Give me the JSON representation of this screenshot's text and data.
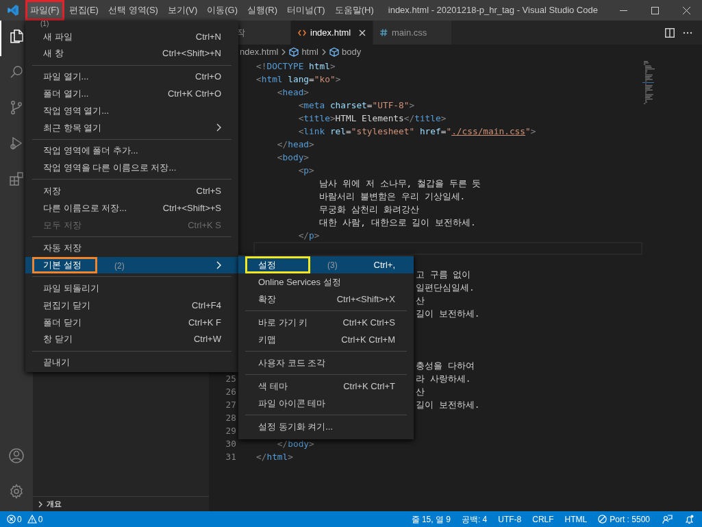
{
  "window": {
    "title": "index.html - 20201218-p_hr_tag - Visual Studio Code"
  },
  "menubar": [
    {
      "label": "파일(F)",
      "selected": true,
      "annotation": {
        "label": "(1)",
        "color": "#e3222c"
      }
    },
    {
      "label": "편집(E)",
      "selected": false
    },
    {
      "label": "선택 영역(S)",
      "selected": false
    },
    {
      "label": "보기(V)",
      "selected": false
    },
    {
      "label": "이동(G)",
      "selected": false
    },
    {
      "label": "실행(R)",
      "selected": false
    },
    {
      "label": "터미널(T)",
      "selected": false
    },
    {
      "label": "도움말(H)",
      "selected": false
    }
  ],
  "activity_bar": {
    "top": [
      {
        "kind": "files",
        "selected": true
      },
      {
        "kind": "search",
        "selected": false
      },
      {
        "kind": "source-control",
        "selected": false
      },
      {
        "kind": "run",
        "selected": false
      },
      {
        "kind": "extensions",
        "selected": false
      }
    ],
    "bottom": [
      {
        "kind": "account",
        "selected": false
      },
      {
        "kind": "settings",
        "selected": false
      }
    ]
  },
  "sidebar": {
    "section": {
      "label": "개요",
      "expanded": false
    }
  },
  "tabs": [
    {
      "label": "작",
      "kind": "plain",
      "selected": false
    },
    {
      "label": "index.html",
      "kind": "html",
      "selected": true
    },
    {
      "label": "main.css",
      "kind": "css",
      "selected": false
    }
  ],
  "breadcrumbs": [
    {
      "label": "ndex.html",
      "kind": "file"
    },
    {
      "label": "html",
      "kind": "element"
    },
    {
      "label": "body",
      "kind": "element"
    }
  ],
  "code_lines": [
    {
      "current": false,
      "tokens": [
        {
          "kind": "punct",
          "text": "<!"
        },
        {
          "kind": "tag",
          "text": "DOCTYPE"
        },
        {
          "kind": "attr",
          "text": " html"
        },
        {
          "kind": "punct",
          "text": ">"
        }
      ]
    },
    {
      "current": false,
      "tokens": [
        {
          "kind": "punct",
          "text": "<"
        },
        {
          "kind": "tag",
          "text": "html"
        },
        {
          "kind": "attr",
          "text": " lang"
        },
        {
          "kind": "text",
          "text": "="
        },
        {
          "kind": "string",
          "text": "\"ko\""
        },
        {
          "kind": "punct",
          "text": ">"
        }
      ]
    },
    {
      "current": false,
      "tokens": [
        {
          "kind": "punct",
          "text": "    <"
        },
        {
          "kind": "tag",
          "text": "head"
        },
        {
          "kind": "punct",
          "text": ">"
        }
      ]
    },
    {
      "current": false,
      "tokens": [
        {
          "kind": "punct",
          "text": "        <"
        },
        {
          "kind": "tag",
          "text": "meta"
        },
        {
          "kind": "attr",
          "text": " charset"
        },
        {
          "kind": "text",
          "text": "="
        },
        {
          "kind": "string",
          "text": "\"UTF-8\""
        },
        {
          "kind": "punct",
          "text": ">"
        }
      ]
    },
    {
      "current": false,
      "tokens": [
        {
          "kind": "punct",
          "text": "        <"
        },
        {
          "kind": "tag",
          "text": "title"
        },
        {
          "kind": "punct",
          "text": ">"
        },
        {
          "kind": "text",
          "text": "HTML Elements"
        },
        {
          "kind": "punct",
          "text": "</"
        },
        {
          "kind": "tag",
          "text": "title"
        },
        {
          "kind": "punct",
          "text": ">"
        }
      ]
    },
    {
      "current": false,
      "tokens": [
        {
          "kind": "punct",
          "text": "        <"
        },
        {
          "kind": "tag",
          "text": "link"
        },
        {
          "kind": "attr",
          "text": " rel"
        },
        {
          "kind": "text",
          "text": "="
        },
        {
          "kind": "string",
          "text": "\"stylesheet\""
        },
        {
          "kind": "attr",
          "text": " href"
        },
        {
          "kind": "text",
          "text": "="
        },
        {
          "kind": "string",
          "text": "\""
        },
        {
          "kind": "link",
          "text": "./css/main.css"
        },
        {
          "kind": "string",
          "text": "\""
        },
        {
          "kind": "punct",
          "text": ">"
        }
      ]
    },
    {
      "current": false,
      "tokens": [
        {
          "kind": "punct",
          "text": "    </"
        },
        {
          "kind": "tag",
          "text": "head"
        },
        {
          "kind": "punct",
          "text": ">"
        }
      ]
    },
    {
      "current": false,
      "tokens": [
        {
          "kind": "punct",
          "text": "    <"
        },
        {
          "kind": "tag",
          "text": "body"
        },
        {
          "kind": "punct",
          "text": ">"
        }
      ]
    },
    {
      "current": false,
      "tokens": [
        {
          "kind": "punct",
          "text": "        <"
        },
        {
          "kind": "tag",
          "text": "p"
        },
        {
          "kind": "punct",
          "text": ">"
        }
      ]
    },
    {
      "current": false,
      "tokens": [
        {
          "kind": "text",
          "text": "            남사 위에 저 소나무, 철갑을 두른 듯"
        }
      ]
    },
    {
      "current": false,
      "tokens": [
        {
          "kind": "text",
          "text": "            바람서리 불변함은 우리 기상일세."
        }
      ]
    },
    {
      "current": false,
      "tokens": [
        {
          "kind": "text",
          "text": "            무궁화 삼천리 화려강산"
        }
      ]
    },
    {
      "current": false,
      "tokens": [
        {
          "kind": "text",
          "text": "            대한 사람, 대한으로 길이 보전하세."
        }
      ]
    },
    {
      "current": false,
      "tokens": [
        {
          "kind": "punct",
          "text": "        </"
        },
        {
          "kind": "tag",
          "text": "p"
        },
        {
          "kind": "punct",
          "text": ">"
        }
      ]
    },
    {
      "current": true
    },
    {
      "current": false
    },
    {
      "current": false,
      "clipped": true,
      "tokens": [
        {
          "kind": "text",
          "text": "고 구름 없이"
        }
      ]
    },
    {
      "current": false,
      "clipped": true,
      "tokens": [
        {
          "kind": "text",
          "text": "일편단심일세."
        }
      ]
    },
    {
      "current": false,
      "clipped": true,
      "tokens": [
        {
          "kind": "text",
          "text": "산"
        }
      ]
    },
    {
      "current": false,
      "clipped": true,
      "tokens": [
        {
          "kind": "text",
          "text": "길이 보전하세."
        }
      ]
    },
    {
      "current": false
    },
    {
      "current": false
    },
    {
      "current": false
    },
    {
      "current": false,
      "clipped": true,
      "tokens": [
        {
          "kind": "text",
          "text": "충성을 다하여"
        }
      ]
    },
    {
      "current": false,
      "number": "25",
      "clipped": true,
      "tokens": [
        {
          "kind": "text",
          "text": "라 사랑하세."
        }
      ]
    },
    {
      "current": false,
      "number": "26",
      "clipped": true,
      "tokens": [
        {
          "kind": "text",
          "text": "산"
        }
      ]
    },
    {
      "current": false,
      "number": "27",
      "clipped": true,
      "tokens": [
        {
          "kind": "text",
          "text": "길이 보전하세."
        }
      ]
    },
    {
      "current": false,
      "number": "28"
    },
    {
      "current": false,
      "number": "29"
    },
    {
      "current": false,
      "number": "30",
      "tokens": [
        {
          "kind": "punct",
          "text": "    </"
        },
        {
          "kind": "tag",
          "text": "body"
        },
        {
          "kind": "punct",
          "text": ">"
        }
      ]
    },
    {
      "current": false,
      "number": "31",
      "tokens": [
        {
          "kind": "punct",
          "text": "</"
        },
        {
          "kind": "tag",
          "text": "html"
        },
        {
          "kind": "punct",
          "text": ">"
        }
      ]
    }
  ],
  "file_menu": [
    {
      "kind": "item",
      "label": "새 파일",
      "shortcut": "Ctrl+N",
      "selected": false,
      "disabled": false,
      "submenu": false
    },
    {
      "kind": "item",
      "label": "새 창",
      "shortcut": "Ctrl+<Shift>+N",
      "selected": false,
      "disabled": false,
      "submenu": false
    },
    {
      "kind": "separator"
    },
    {
      "kind": "item",
      "label": "파일 열기...",
      "shortcut": "Ctrl+O",
      "selected": false,
      "disabled": false,
      "submenu": false
    },
    {
      "kind": "item",
      "label": "폴더 열기...",
      "shortcut": "Ctrl+K Ctrl+O",
      "selected": false,
      "disabled": false,
      "submenu": false
    },
    {
      "kind": "item",
      "label": "작업 영역 열기...",
      "selected": false,
      "disabled": false,
      "submenu": false
    },
    {
      "kind": "item",
      "label": "최근 항목 열기",
      "selected": false,
      "disabled": false,
      "submenu": true
    },
    {
      "kind": "separator"
    },
    {
      "kind": "item",
      "label": "작업 영역에 폴더 추가...",
      "selected": false,
      "disabled": false,
      "submenu": false
    },
    {
      "kind": "item",
      "label": "작업 영역을 다른 이름으로 저장...",
      "selected": false,
      "disabled": false,
      "submenu": false
    },
    {
      "kind": "separator"
    },
    {
      "kind": "item",
      "label": "저장",
      "shortcut": "Ctrl+S",
      "selected": false,
      "disabled": false,
      "submenu": false
    },
    {
      "kind": "item",
      "label": "다른 이름으로 저장...",
      "shortcut": "Ctrl+<Shift>+S",
      "selected": false,
      "disabled": false,
      "submenu": false
    },
    {
      "kind": "item",
      "label": "모두 저장",
      "shortcut": "Ctrl+K S",
      "selected": false,
      "disabled": true,
      "submenu": false
    },
    {
      "kind": "separator"
    },
    {
      "kind": "item",
      "label": "자동 저장",
      "selected": false,
      "disabled": false,
      "submenu": false
    },
    {
      "kind": "item",
      "label": "기본 설정",
      "selected": true,
      "disabled": false,
      "submenu": true,
      "annotation": {
        "label": "(2)",
        "color": "#f0852d"
      }
    },
    {
      "kind": "separator"
    },
    {
      "kind": "item",
      "label": "파일 되돌리기",
      "selected": false,
      "disabled": false,
      "submenu": false
    },
    {
      "kind": "item",
      "label": "편집기 닫기",
      "shortcut": "Ctrl+F4",
      "selected": false,
      "disabled": false,
      "submenu": false
    },
    {
      "kind": "item",
      "label": "폴더 닫기",
      "shortcut": "Ctrl+K F",
      "selected": false,
      "disabled": false,
      "submenu": false
    },
    {
      "kind": "item",
      "label": "창 닫기",
      "shortcut": "Ctrl+W",
      "selected": false,
      "disabled": false,
      "submenu": false
    },
    {
      "kind": "separator"
    },
    {
      "kind": "item",
      "label": "끝내기",
      "selected": false,
      "disabled": false,
      "submenu": false
    }
  ],
  "preferences_menu": [
    {
      "kind": "item",
      "label": "설정",
      "shortcut": "Ctrl+,",
      "selected": true,
      "disabled": false,
      "submenu": false,
      "annotation": {
        "label": "(3)",
        "color": "#f2e81e"
      }
    },
    {
      "kind": "item",
      "label": "Online Services 설정",
      "selected": false,
      "disabled": false,
      "submenu": false
    },
    {
      "kind": "item",
      "label": "확장",
      "shortcut": "Ctrl+<Shift>+X",
      "selected": false,
      "disabled": false,
      "submenu": false
    },
    {
      "kind": "separator"
    },
    {
      "kind": "item",
      "label": "바로 가기 키",
      "shortcut": "Ctrl+K Ctrl+S",
      "selected": false,
      "disabled": false,
      "submenu": false
    },
    {
      "kind": "item",
      "label": "키맵",
      "shortcut": "Ctrl+K Ctrl+M",
      "selected": false,
      "disabled": false,
      "submenu": false
    },
    {
      "kind": "separator"
    },
    {
      "kind": "item",
      "label": "사용자 코드 조각",
      "selected": false,
      "disabled": false,
      "submenu": false
    },
    {
      "kind": "separator"
    },
    {
      "kind": "item",
      "label": "색 테마",
      "shortcut": "Ctrl+K Ctrl+T",
      "selected": false,
      "disabled": false,
      "submenu": false
    },
    {
      "kind": "item",
      "label": "파일 아이콘 테마",
      "selected": false,
      "disabled": false,
      "submenu": false
    },
    {
      "kind": "separator"
    },
    {
      "kind": "item",
      "label": "설정 동기화 켜기...",
      "selected": false,
      "disabled": false,
      "submenu": false
    }
  ],
  "status_bar": {
    "left": [
      {
        "kind": "errors",
        "text": "0"
      },
      {
        "kind": "warnings",
        "text": "0"
      }
    ],
    "right": [
      {
        "kind": "text",
        "text": "줄 15, 열 9"
      },
      {
        "kind": "text",
        "text": "공백: 4"
      },
      {
        "kind": "text",
        "text": "UTF-8"
      },
      {
        "kind": "text",
        "text": "CRLF"
      },
      {
        "kind": "text",
        "text": "HTML"
      },
      {
        "kind": "port",
        "text": "Port : 5500"
      },
      {
        "kind": "feedback"
      },
      {
        "kind": "bell"
      }
    ]
  }
}
